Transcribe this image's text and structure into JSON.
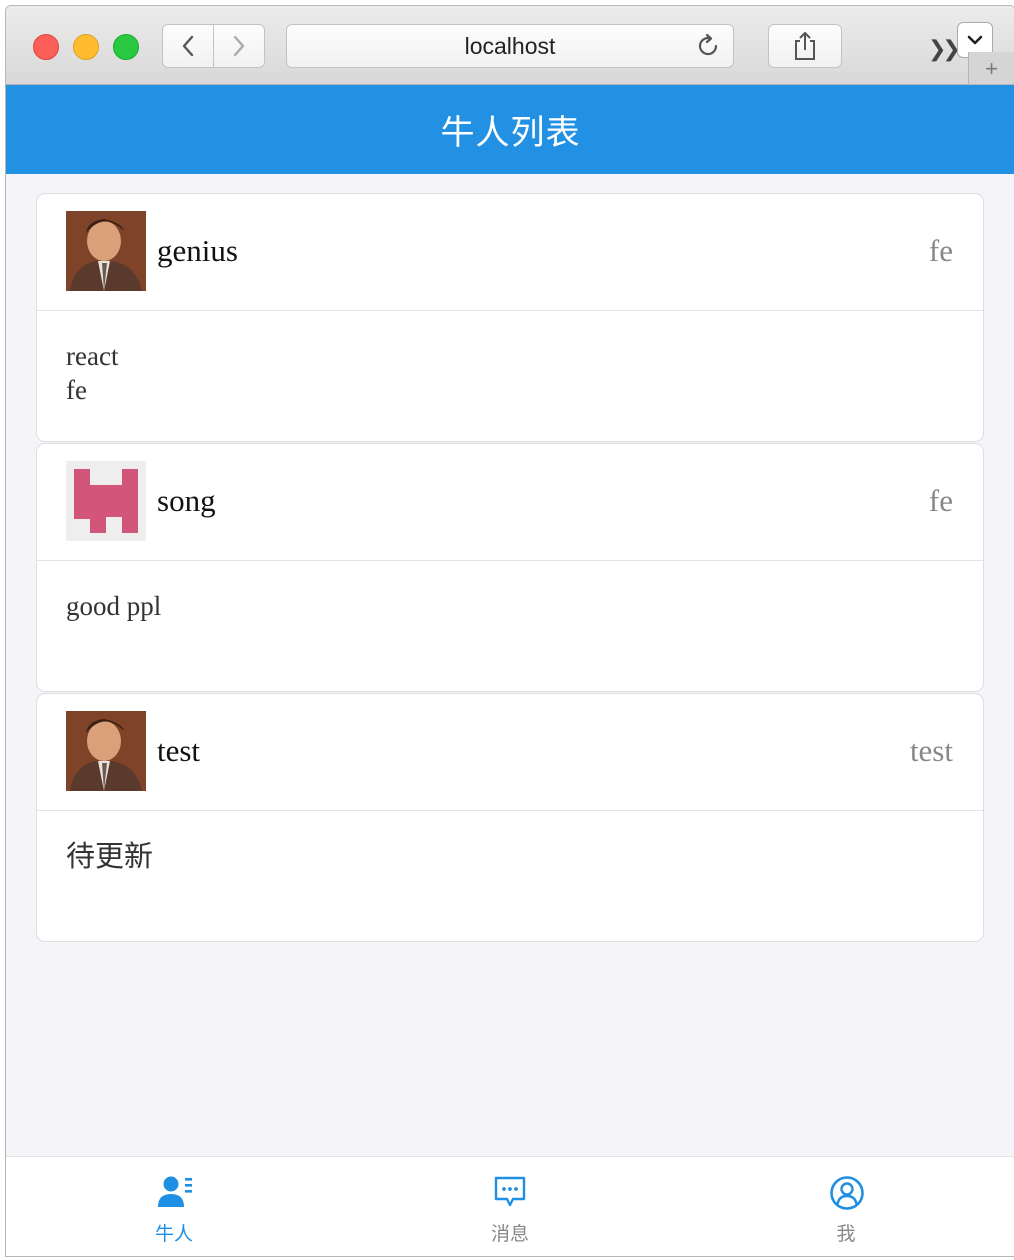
{
  "browser": {
    "address": "localhost",
    "icons": [
      "back-icon",
      "forward-icon",
      "reload-icon",
      "share-icon",
      "overflow-chevrons-icon",
      "dropdown-chevron-icon",
      "new-tab-plus-icon"
    ]
  },
  "navbar": {
    "title": "牛人列表"
  },
  "cards": [
    {
      "name": "genius",
      "extra": "fe",
      "lines": [
        "react",
        "fe"
      ],
      "avatar": "photo-avatar"
    },
    {
      "name": "song",
      "extra": "fe",
      "lines": [
        "good ppl"
      ],
      "avatar": "identicon-avatar"
    },
    {
      "name": "test",
      "extra": "test",
      "lines": [
        "待更新"
      ],
      "avatar": "photo-avatar"
    }
  ],
  "tabbar": {
    "tabs": [
      {
        "label": "牛人",
        "icon": "boss-list-icon",
        "active": true
      },
      {
        "label": "消息",
        "icon": "message-icon",
        "active": false
      },
      {
        "label": "我",
        "icon": "user-icon",
        "active": false
      }
    ]
  },
  "colors": {
    "accent": "#2291e4",
    "identicon": "#d4557a",
    "background": "#f5f5f9"
  }
}
